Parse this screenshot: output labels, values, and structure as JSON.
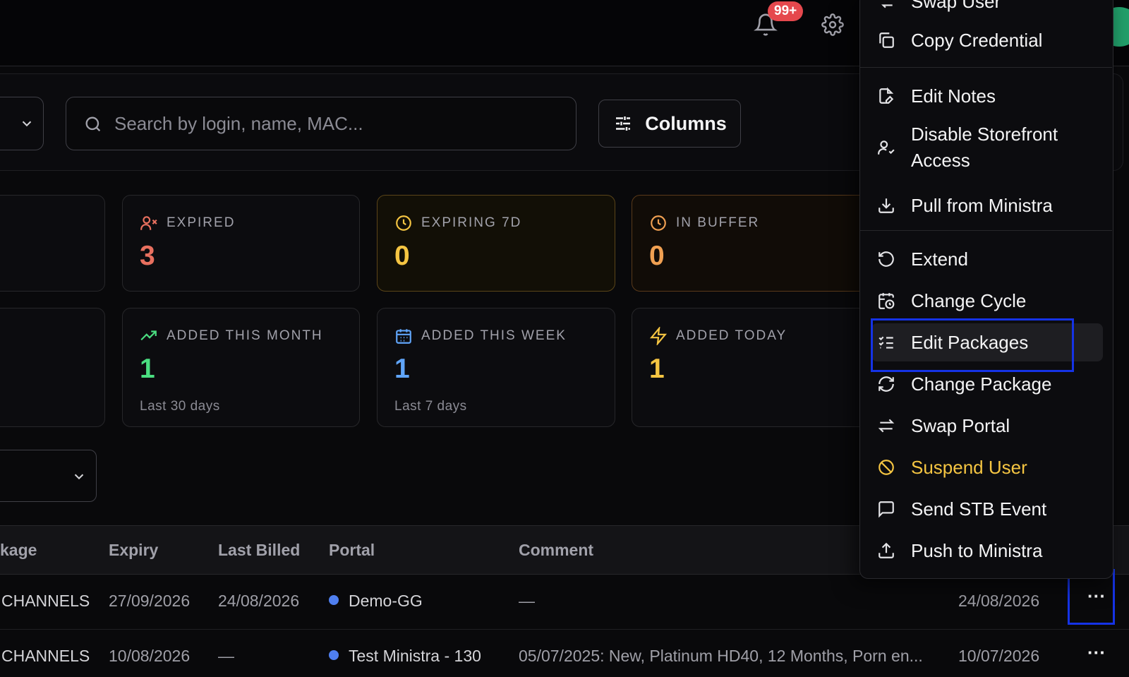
{
  "header": {
    "notification_count": "99+",
    "icons": [
      "bell-icon",
      "gear-icon"
    ]
  },
  "toolbar": {
    "search_placeholder": "Search by login, name, MAC...",
    "columns_label": "Columns"
  },
  "stats": [
    {
      "label": "EXPIRED",
      "value": "3",
      "sub": "",
      "icon": "user-x-icon",
      "color": "#e8705f"
    },
    {
      "label": "EXPIRING 7D",
      "value": "0",
      "sub": "",
      "icon": "clock-icon",
      "color": "#f5c542"
    },
    {
      "label": "IN BUFFER",
      "value": "0",
      "sub": "",
      "icon": "clock-icon",
      "color": "#f0a052"
    },
    {
      "label": "ADDED THIS MONTH",
      "value": "1",
      "sub": "Last 30 days",
      "icon": "trending-up-icon",
      "color": "#4ade80"
    },
    {
      "label": "ADDED THIS WEEK",
      "value": "1",
      "sub": "Last 7 days",
      "icon": "calendar-icon",
      "color": "#60a5fa"
    },
    {
      "label": "ADDED TODAY",
      "value": "1",
      "sub": "",
      "icon": "zap-icon",
      "color": "#f5c542"
    }
  ],
  "table": {
    "columns": [
      "kage",
      "Expiry",
      "Last Billed",
      "Portal",
      "Comment"
    ],
    "rows": [
      {
        "package": "CHANNELS",
        "expiry": "27/09/2026",
        "last_billed": "24/08/2026",
        "portal": "Demo-GG",
        "comment": "—",
        "created": "24/08/2026"
      },
      {
        "package": "CHANNELS",
        "expiry": "10/08/2026",
        "last_billed": "—",
        "portal": "Test Ministra - 130",
        "comment": "05/07/2025: New, Platinum HD40, 12 Months, Porn en...",
        "created": "10/07/2026"
      }
    ],
    "more_label": "···"
  },
  "menu": {
    "items": [
      {
        "label": "Swap User",
        "icon": "user-swap-icon"
      },
      {
        "label": "Copy Credential",
        "icon": "copy-icon"
      },
      {
        "label": "Edit Notes",
        "icon": "file-edit-icon"
      },
      {
        "label": "Disable Storefront Access",
        "icon": "user-check-icon"
      },
      {
        "label": "Pull from Ministra",
        "icon": "download-icon"
      },
      {
        "label": "Extend",
        "icon": "rotate-ccw-icon"
      },
      {
        "label": "Change Cycle",
        "icon": "calendar-clock-icon"
      },
      {
        "label": "Edit Packages",
        "icon": "list-checks-icon"
      },
      {
        "label": "Change Package",
        "icon": "refresh-icon"
      },
      {
        "label": "Swap Portal",
        "icon": "arrows-swap-icon"
      },
      {
        "label": "Suspend User",
        "icon": "ban-icon"
      },
      {
        "label": "Send STB Event",
        "icon": "message-square-icon"
      },
      {
        "label": "Push to Ministra",
        "icon": "upload-icon"
      }
    ],
    "warning_color": "#f5c542"
  }
}
